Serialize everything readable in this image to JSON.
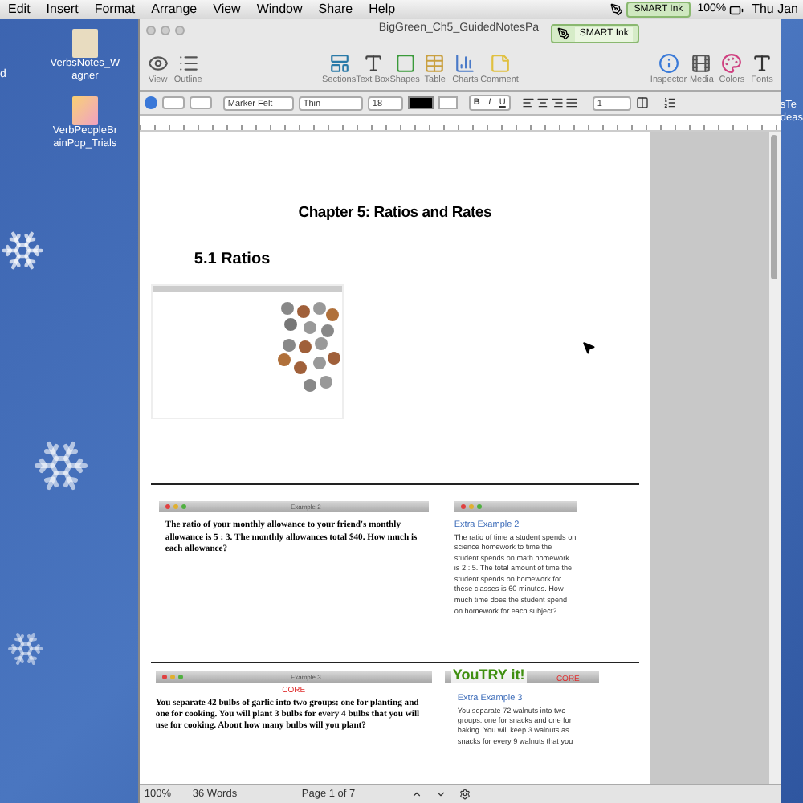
{
  "menu_bar": {
    "items": [
      "Edit",
      "Insert",
      "Format",
      "Arrange",
      "View",
      "Window",
      "Share",
      "Help"
    ],
    "smart_ink": "SMART Ink",
    "battery": "100%",
    "clock": "Thu Jan"
  },
  "desktop": {
    "left_edge_text": "d",
    "icons": [
      {
        "label": "VerbsNotes_W agner"
      },
      {
        "label": "VerbPeopleBr ainPop_Trials"
      }
    ],
    "right_icon_label": [
      "sTe",
      "deas"
    ]
  },
  "window": {
    "title": "BigGreen_Ch5_GuidedNotesPa",
    "smart_ink_overlay": "SMART Ink",
    "toolbar": [
      {
        "label": "View",
        "kind": "view"
      },
      {
        "label": "Outline",
        "kind": "outline"
      },
      {
        "label": "Sections",
        "kind": "sections"
      },
      {
        "label": "Text Box",
        "kind": "textbox"
      },
      {
        "label": "Shapes",
        "kind": "shapes"
      },
      {
        "label": "Table",
        "kind": "table"
      },
      {
        "label": "Charts",
        "kind": "charts"
      },
      {
        "label": "Comment",
        "kind": "comment"
      },
      {
        "label": "Inspector",
        "kind": "inspector"
      },
      {
        "label": "Media",
        "kind": "media"
      },
      {
        "label": "Colors",
        "kind": "colors"
      },
      {
        "label": "Fonts",
        "kind": "fonts"
      }
    ],
    "format_bar": {
      "font": "Marker Felt",
      "typeface": "Thin",
      "size": "18",
      "line_spacing": "1",
      "bold": "B",
      "italic": "I",
      "underline": "U"
    },
    "status_bar": {
      "zoom": "100%",
      "words": "36 Words",
      "page": "Page 1 of 7"
    }
  },
  "document": {
    "heading": "Chapter 5: Ratios and Rates",
    "section": "5.1 Ratios",
    "example_2": {
      "title": "Example 2",
      "text": "The ratio of your monthly allowance to your friend's monthly allowance is 5 : 3. The monthly allowances total $40. How much is each allowance?"
    },
    "extra_example_2": {
      "title": "Extra Example 2",
      "text": "The ratio of time a student spends on science homework to time the student spends on math homework is 2 : 5. The total amount of time the student spends on homework for these classes is 60 minutes. How much time does the student spend on homework for each subject?"
    },
    "example_3": {
      "title": "Example 3",
      "tag": "CORE",
      "text": "You separate 42 bulbs of garlic into two groups: one for planting and one for cooking. You will plant 3 bulbs for every 4 bulbs that you will use for cooking. About how many bulbs will you plant?"
    },
    "extra_example_3": {
      "banner": "YouTRY it!",
      "tag": "CORE",
      "title": "Extra Example 3",
      "text": "You separate 72 walnuts into two groups: one for snacks and one for baking. You will keep 3 walnuts as snacks for every 9 walnuts that you"
    }
  }
}
